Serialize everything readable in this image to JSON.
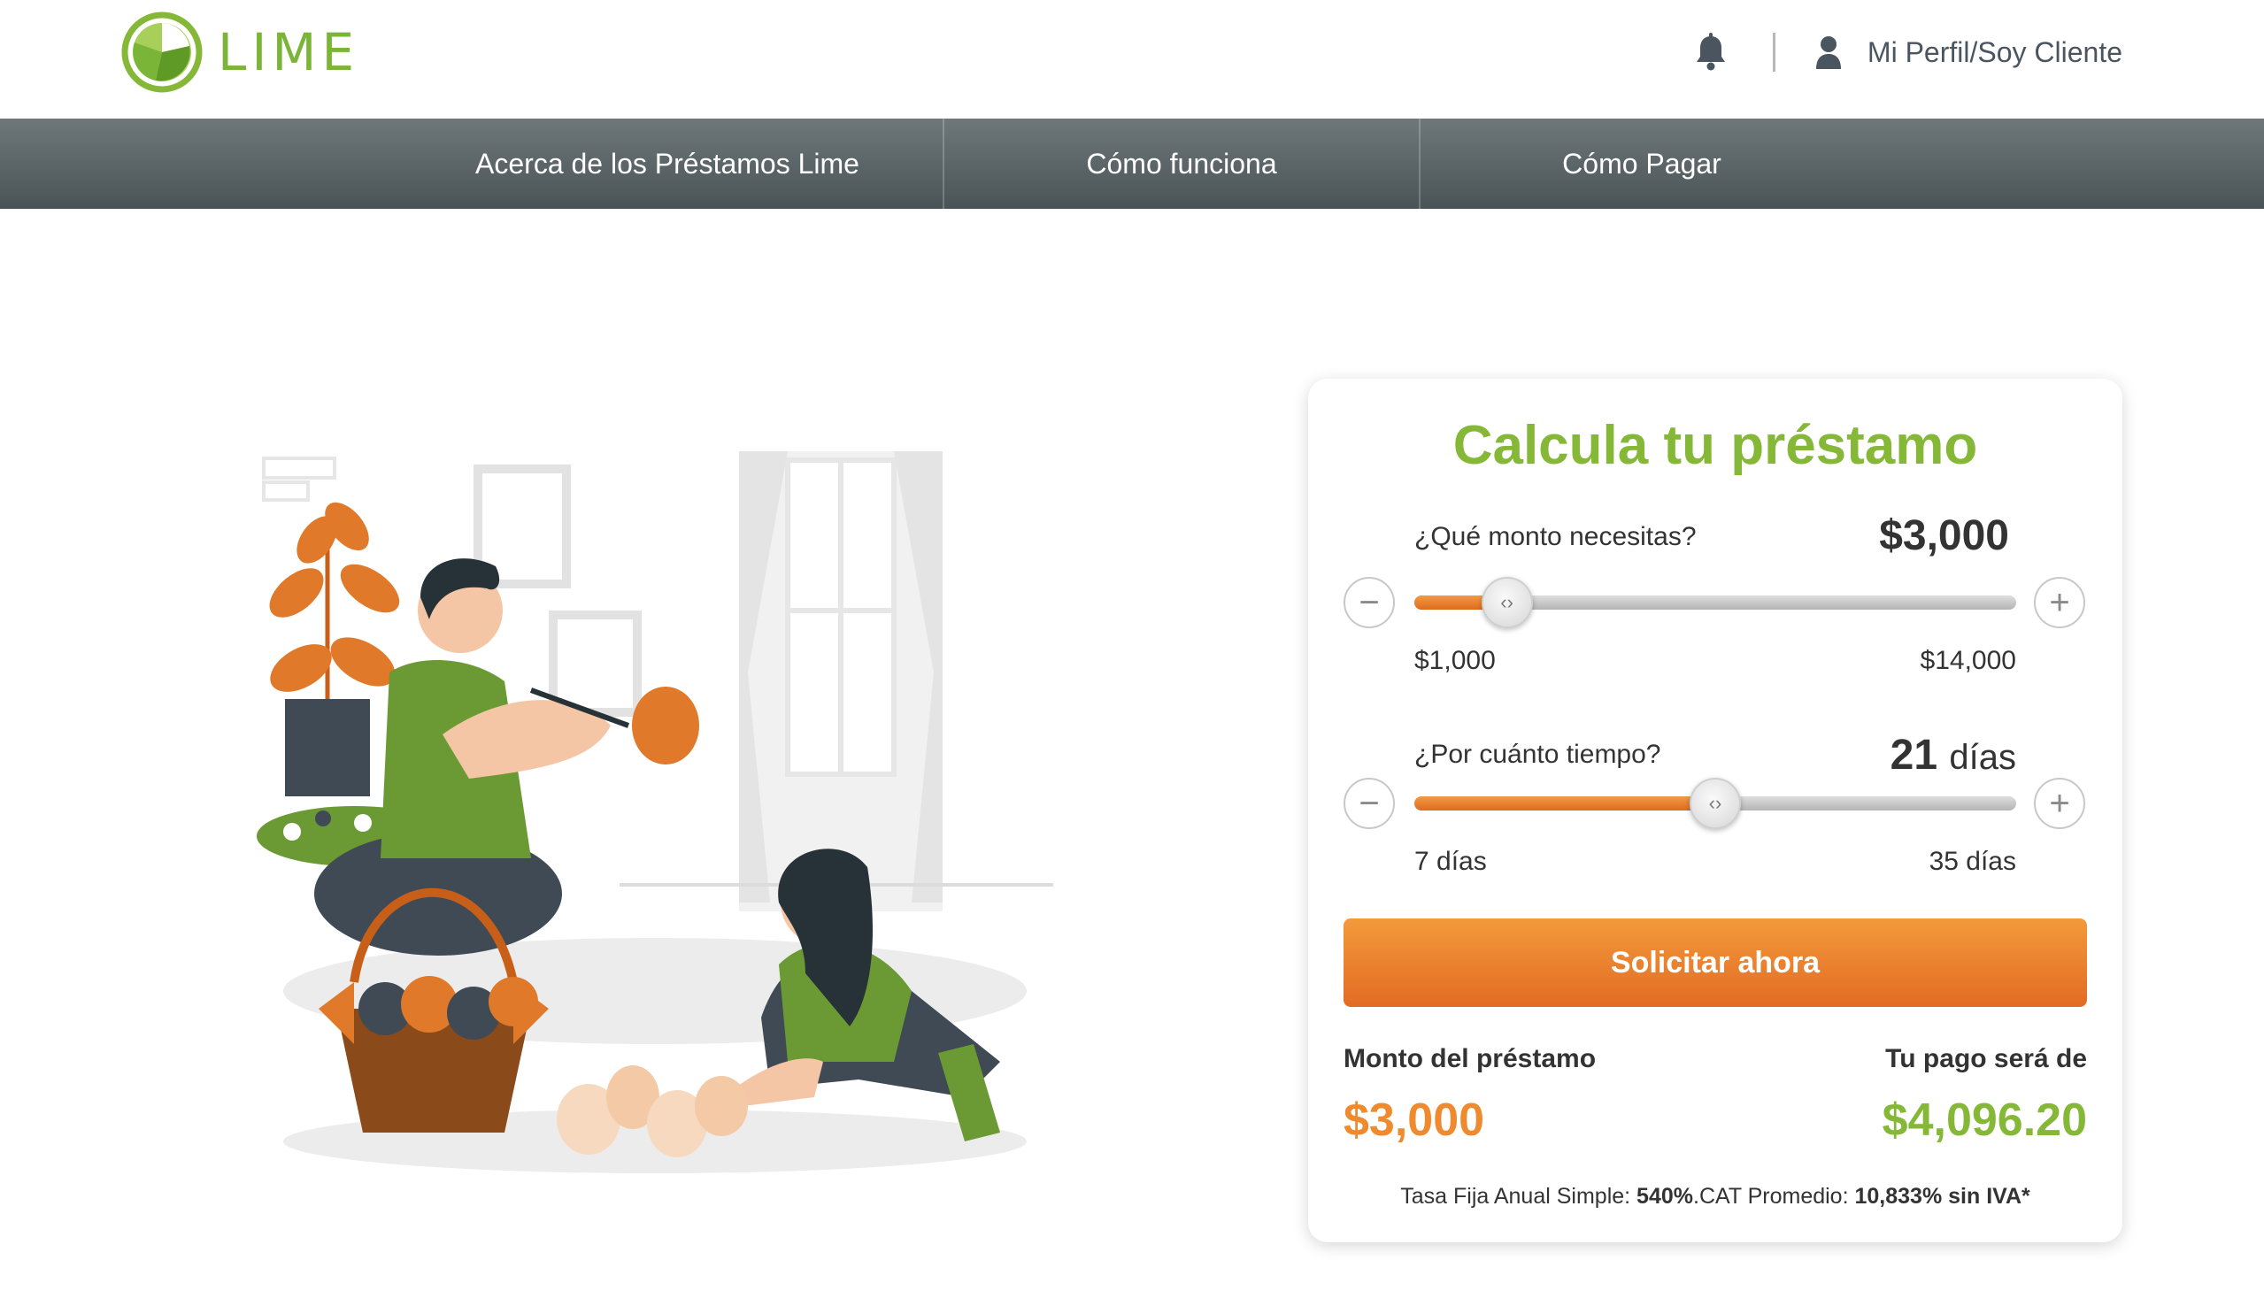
{
  "header": {
    "logo_text": "LIME",
    "profile_label": "Mi Perfil/Soy Cliente",
    "icons": [
      "bell-icon",
      "user-icon"
    ]
  },
  "nav": {
    "items": [
      {
        "label": "Acerca de los Préstamos Lime"
      },
      {
        "label": "Cómo funciona"
      },
      {
        "label": "Cómo Pagar"
      }
    ]
  },
  "calculator": {
    "title": "Calcula tu préstamo",
    "amount": {
      "label": "¿Qué monto necesitas?",
      "value": "$3,000",
      "min_label": "$1,000",
      "max_label": "$14,000",
      "min": 1000,
      "max": 14000,
      "current": 3000
    },
    "term": {
      "label": "¿Por cuánto tiempo?",
      "value_number": "21",
      "value_unit": "días",
      "min_label": "7 días",
      "max_label": "35 días",
      "min": 7,
      "max": 35,
      "current": 21
    },
    "cta_label": "Solicitar ahora",
    "summary": {
      "loan_label": "Monto del préstamo",
      "loan_value": "$3,000",
      "payment_label": "Tu pago será de",
      "payment_value": "$4,096.20"
    },
    "footnote": {
      "rate_label": "Tasa Fija Anual Simple: ",
      "rate_value": "540%",
      "cat_label": ".CAT Promedio: ",
      "cat_value": "10,833% sin IVA*"
    }
  },
  "colors": {
    "brand_green": "#86b838",
    "accent_orange": "#e8792a",
    "nav_bg": "#5a6467"
  }
}
